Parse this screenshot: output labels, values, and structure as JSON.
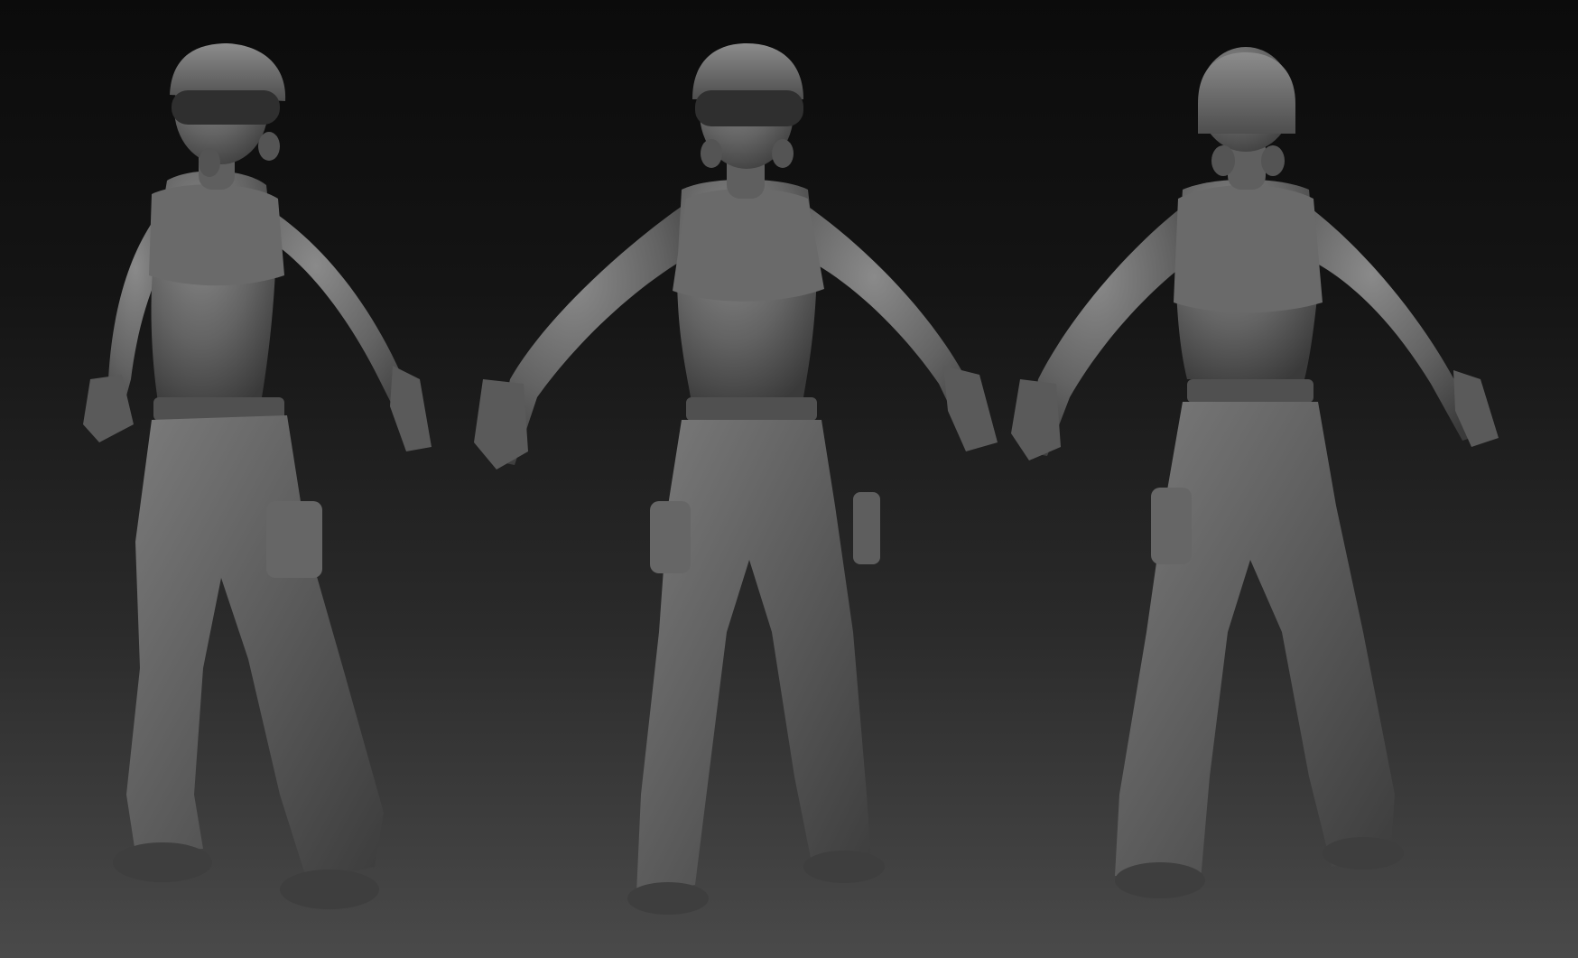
{
  "scene": {
    "background_top": "#0b0b0b",
    "background_bottom": "#4a4a4a",
    "clay_color": "#6e6e6e"
  },
  "figures": [
    {
      "view": "three-quarter-front"
    },
    {
      "view": "front"
    },
    {
      "view": "back"
    }
  ]
}
